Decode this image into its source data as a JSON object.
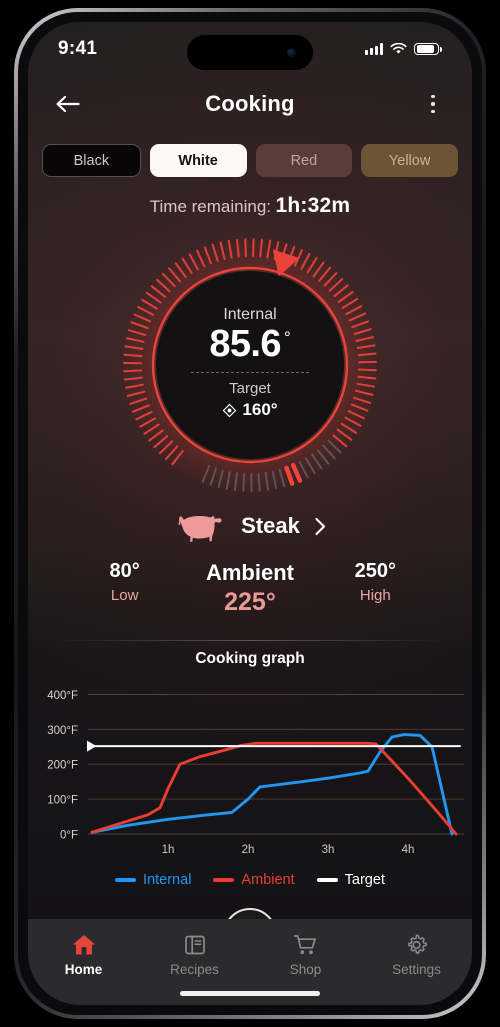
{
  "status_bar": {
    "time": "9:41",
    "signal_icon": "cellular-bars-icon",
    "wifi_icon": "wifi-icon",
    "battery_icon": "battery-icon"
  },
  "header": {
    "back_icon": "back-arrow-icon",
    "title": "Cooking",
    "menu_icon": "kebab-menu-icon"
  },
  "chips": [
    {
      "label": "Black",
      "style": "black",
      "selected": false
    },
    {
      "label": "White",
      "style": "white",
      "selected": true
    },
    {
      "label": "Red",
      "style": "red",
      "selected": false
    },
    {
      "label": "Yellow",
      "style": "yellow",
      "selected": false
    }
  ],
  "time_remaining": {
    "label": "Time remaining:",
    "value": "1h:32m"
  },
  "gauge": {
    "internal_label": "Internal",
    "internal_value": "85.6",
    "degree_symbol": "°",
    "target_label": "Target",
    "target_icon": "target-diamond-icon",
    "target_value": "160°",
    "internal_numeric": 85.6,
    "target_numeric": 160,
    "range_min": 0,
    "range_max": 260
  },
  "food": {
    "icon": "cow-icon",
    "name": "Steak",
    "chevron_icon": "chevron-right-icon"
  },
  "stats": {
    "low_value": "80°",
    "low_label": "Low",
    "ambient_label": "Ambient",
    "ambient_value": "225°",
    "high_value": "250°",
    "high_label": "High"
  },
  "chart_data": {
    "type": "line",
    "title": "Cooking graph",
    "xlabel": "",
    "ylabel": "",
    "xlim": [
      0,
      4.7
    ],
    "ylim": [
      0,
      430
    ],
    "grid": true,
    "legend_position": "bottom",
    "x_ticks": [
      1,
      2,
      3,
      4
    ],
    "x_tick_labels": [
      "1h",
      "2h",
      "3h",
      "4h"
    ],
    "y_ticks": [
      0,
      100,
      200,
      300,
      400
    ],
    "y_tick_labels": [
      "0°F",
      "100°F",
      "200°F",
      "300°F",
      "400°F"
    ],
    "series": [
      {
        "name": "Internal",
        "color": "#2196f3",
        "x": [
          0.05,
          0.5,
          1.0,
          1.5,
          1.8,
          2.0,
          2.15,
          2.6,
          3.0,
          3.4,
          3.5,
          3.65,
          3.8,
          3.95,
          4.15,
          4.3,
          4.55
        ],
        "values": [
          5,
          25,
          42,
          55,
          62,
          100,
          135,
          148,
          160,
          175,
          180,
          235,
          278,
          285,
          283,
          250,
          0
        ]
      },
      {
        "name": "Ambient",
        "color": "#ea3d33",
        "x": [
          0.05,
          0.4,
          0.75,
          0.9,
          1.0,
          1.15,
          1.4,
          1.7,
          1.9,
          2.1,
          3.0,
          3.5,
          3.6,
          4.0,
          4.4,
          4.6
        ],
        "values": [
          5,
          30,
          55,
          75,
          130,
          200,
          222,
          240,
          253,
          260,
          260,
          260,
          258,
          160,
          55,
          0
        ]
      },
      {
        "name": "Target",
        "color": "#ffffff",
        "x": [
          0.05,
          4.65
        ],
        "values": [
          252,
          252
        ],
        "is_threshold": true,
        "marker": "left-triangle"
      }
    ],
    "legend": [
      {
        "label": "Internal",
        "color": "#2196f3"
      },
      {
        "label": "Ambient",
        "color": "#ea3d33"
      },
      {
        "label": "Target",
        "color": "#ffffff"
      }
    ]
  },
  "fab": {
    "icon": "minus-dash-icon"
  },
  "tabbar": [
    {
      "label": "Home",
      "icon": "home-icon",
      "active": true
    },
    {
      "label": "Recipes",
      "icon": "book-icon",
      "active": false
    },
    {
      "label": "Shop",
      "icon": "cart-icon",
      "active": false
    },
    {
      "label": "Settings",
      "icon": "gear-icon",
      "active": false
    }
  ],
  "colors": {
    "accent_red": "#e3453c",
    "internal_blue": "#2196f3",
    "ambient_red": "#ea3d33",
    "target_white": "#ffffff",
    "salmon": "#e89a93"
  }
}
